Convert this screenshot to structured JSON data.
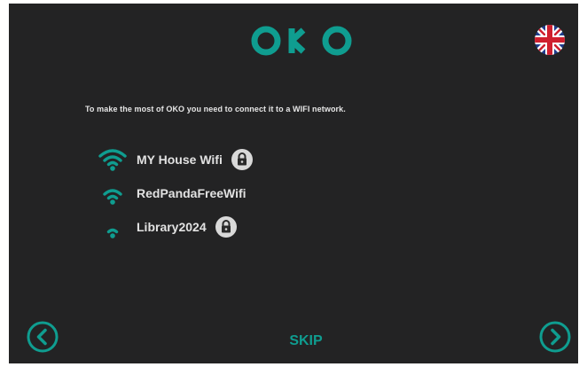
{
  "app": {
    "logo_text": "OKO",
    "language": "English (UK)",
    "accent_color": "#0f9d90",
    "background_color": "#232324"
  },
  "intro_text": "To make the most of OKO you need to connect it to a WIFI network.",
  "networks": [
    {
      "name": "MY House Wifi",
      "signal_bars": 3,
      "secured": true,
      "icon": "wifi-strong-icon"
    },
    {
      "name": "RedPandaFreeWifi",
      "signal_bars": 2,
      "secured": false,
      "icon": "wifi-medium-icon"
    },
    {
      "name": "Library2024",
      "signal_bars": 1,
      "secured": true,
      "icon": "wifi-weak-icon"
    }
  ],
  "footer": {
    "skip_label": "SKIP",
    "back_icon": "chevron-left-circle-icon",
    "next_icon": "chevron-right-circle-icon"
  }
}
